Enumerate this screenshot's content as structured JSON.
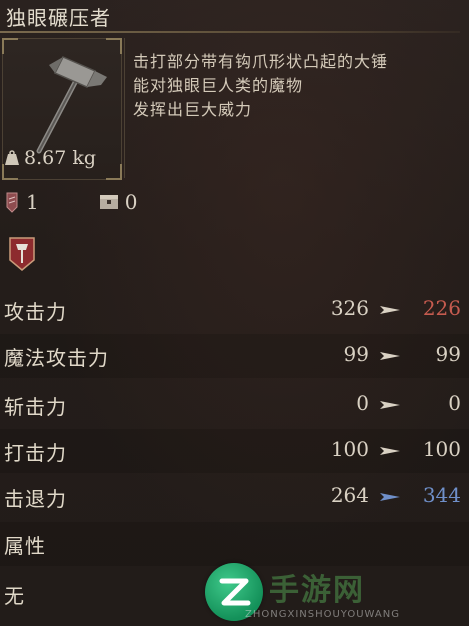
{
  "item": {
    "name": "独眼碾压者",
    "weight": "8.67 kg",
    "description": [
      "击打部分带有钩爪形状凸起的大锤",
      "能对独眼巨人类的魔物",
      "发挥出巨大威力"
    ],
    "slot_count_a": "1",
    "slot_count_b": "0"
  },
  "stats": [
    {
      "label": "攻击力",
      "base": "326",
      "new": "226",
      "new_color": "#c65b4f"
    },
    {
      "label": "魔法攻击力",
      "base": "99",
      "new": "99",
      "new_color": "#d9d1c3"
    },
    {
      "label": "斩击力",
      "base": "0",
      "new": "0",
      "new_color": "#d9d1c3"
    },
    {
      "label": "打击力",
      "base": "100",
      "new": "100",
      "new_color": "#d9d1c3"
    },
    {
      "label": "击退力",
      "base": "264",
      "new": "344",
      "new_color": "#6f8fc9"
    }
  ],
  "attribute": {
    "label": "属性",
    "value": "无"
  },
  "watermark": {
    "text": "手游网",
    "sub": "ZHONGXINSHOUYOUWANG"
  },
  "colors": {
    "accent_gold": "#8a7a58",
    "decrease": "#c65b4f",
    "increase": "#6f8fc9"
  }
}
